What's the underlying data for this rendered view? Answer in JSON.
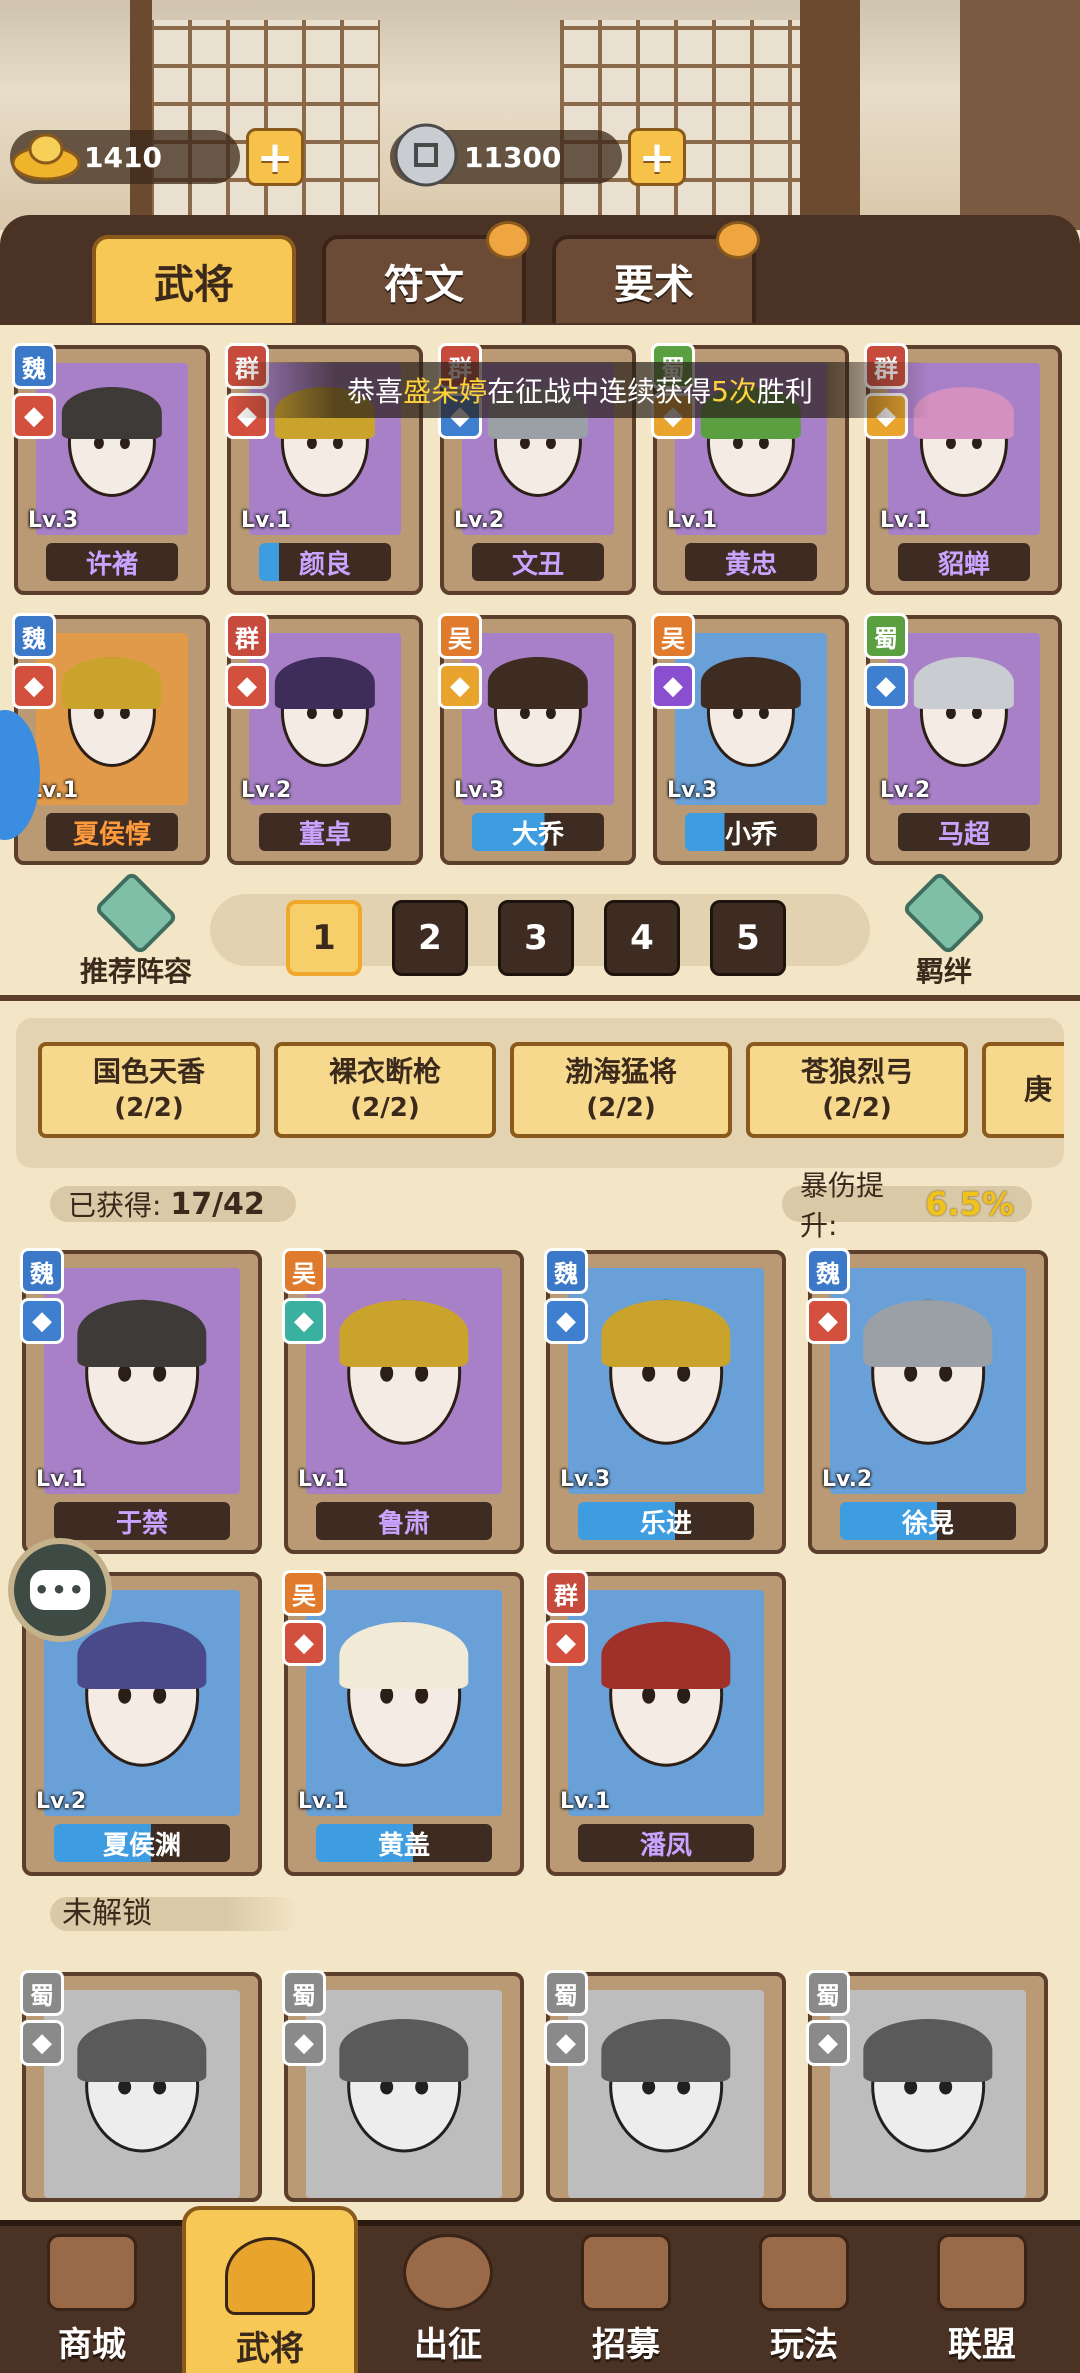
{
  "currency": {
    "gold": {
      "value": "1410",
      "icon": "gold-ingot-icon"
    },
    "coin": {
      "value": "11300",
      "icon": "copper-coin-icon"
    }
  },
  "tabs": [
    {
      "label": "武将",
      "active": true
    },
    {
      "label": "符文",
      "active": false
    },
    {
      "label": "要术",
      "active": false
    }
  ],
  "notice": {
    "prefix": "恭喜",
    "player": "盛朵婷",
    "middle": "在征战中连续获得",
    "streak": "5次",
    "suffix": "胜利"
  },
  "lineup_heroes": [
    {
      "name": "许褚",
      "faction": "魏",
      "level": "Lv.3",
      "portrait": "#a880c8"
    },
    {
      "name": "颜良",
      "faction": "群",
      "level": "Lv.1",
      "portrait": "#a880c8"
    },
    {
      "name": "文丑",
      "faction": "群",
      "level": "Lv.2",
      "portrait": "#a880c8"
    },
    {
      "name": "黄忠",
      "faction": "蜀",
      "level": "Lv.1",
      "portrait": "#a880c8"
    },
    {
      "name": "貂蝉",
      "faction": "群",
      "level": "Lv.1",
      "portrait": "#a880c8"
    },
    {
      "name": "夏侯惇",
      "faction": "魏",
      "level": "Lv.1",
      "portrait": "#e09a4a"
    },
    {
      "name": "董卓",
      "faction": "群",
      "level": "Lv.2",
      "portrait": "#a880c8"
    },
    {
      "name": "大乔",
      "faction": "吴",
      "level": "Lv.3",
      "portrait": "#a880c8"
    },
    {
      "name": "小乔",
      "faction": "吴",
      "level": "Lv.3",
      "portrait": "#6aa0d8"
    },
    {
      "name": "马超",
      "faction": "蜀",
      "level": "Lv.2",
      "portrait": "#a880c8"
    }
  ],
  "formation": {
    "recommend_label": "推荐阵容",
    "bond_label": "羁绊",
    "slots": [
      "1",
      "2",
      "3",
      "4",
      "5"
    ],
    "active_slot": "1"
  },
  "bonds": [
    {
      "name": "国色天香",
      "count": "(2/2)"
    },
    {
      "name": "裸衣断枪",
      "count": "(2/2)"
    },
    {
      "name": "渤海猛将",
      "count": "(2/2)"
    },
    {
      "name": "苍狼烈弓",
      "count": "(2/2)"
    },
    {
      "name": "庚",
      "count": ""
    }
  ],
  "stats": {
    "obtained_label": "已获得:",
    "obtained_value": "17/42",
    "crit_label": "暴伤提升:",
    "crit_value": "6.5%"
  },
  "owned_heroes": [
    {
      "name": "于禁",
      "faction": "魏",
      "level": "Lv.1",
      "portrait": "#a880c8"
    },
    {
      "name": "鲁肃",
      "faction": "吴",
      "level": "Lv.1",
      "portrait": "#a880c8"
    },
    {
      "name": "乐进",
      "faction": "魏",
      "level": "Lv.3",
      "portrait": "#6aa0d8"
    },
    {
      "name": "徐晃",
      "faction": "魏",
      "level": "Lv.2",
      "portrait": "#6aa0d8"
    },
    {
      "name": "夏侯渊",
      "faction": "",
      "level": "Lv.2",
      "portrait": "#6aa0d8"
    },
    {
      "name": "黄盖",
      "faction": "吴",
      "level": "Lv.1",
      "portrait": "#6aa0d8"
    },
    {
      "name": "潘凤",
      "faction": "群",
      "level": "Lv.1",
      "portrait": "#6aa0d8"
    }
  ],
  "locked_section": {
    "label": "未解锁",
    "heroes": [
      {
        "faction": "蜀"
      },
      {
        "faction": "蜀"
      },
      {
        "faction": "蜀"
      },
      {
        "faction": "蜀"
      }
    ]
  },
  "bottom_nav": [
    {
      "label": "商城",
      "icon": "shop-icon"
    },
    {
      "label": "武将",
      "icon": "helmet-icon",
      "active": true
    },
    {
      "label": "出征",
      "icon": "battle-icon"
    },
    {
      "label": "招募",
      "icon": "recruit-icon"
    },
    {
      "label": "玩法",
      "icon": "gameplay-icon"
    },
    {
      "label": "联盟",
      "icon": "alliance-icon"
    }
  ]
}
